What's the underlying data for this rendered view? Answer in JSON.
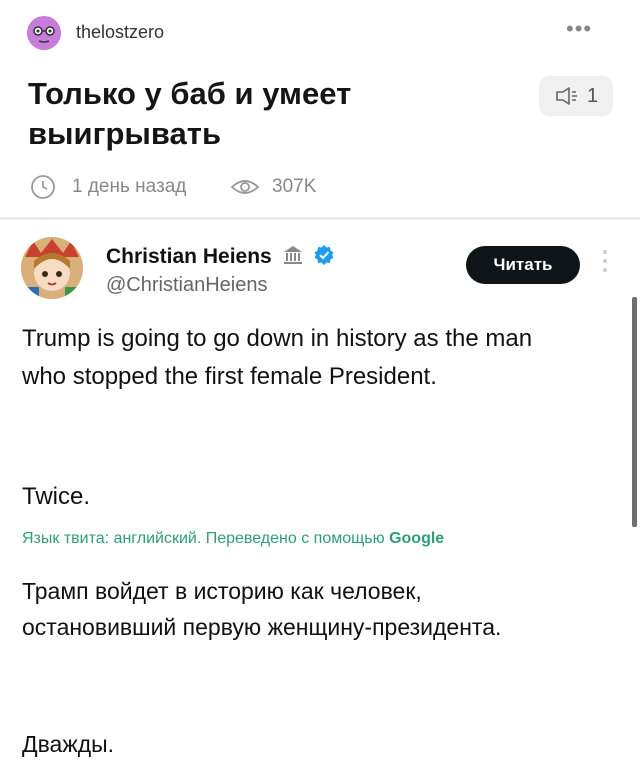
{
  "post": {
    "username": "thelostzero",
    "more_label": "•••",
    "title": "Только у баб и умеет выигрывать",
    "comment_count": "1",
    "time_ago": "1 день назад",
    "views": "307K"
  },
  "tweet": {
    "author_name": "Christian Heiens",
    "author_handle": "@ChristianHeiens",
    "read_button": "Читать",
    "text_line1": "Trump is going to go down in history as the man who stopped the first female President.",
    "text_line2": "Twice.",
    "translation_note": "Язык твита: английский. Переведено с помощью",
    "translation_provider": "Google",
    "translated_line1": "Трамп войдет в историю как человек, остановивший первую женщину-президента.",
    "translated_line2": "Дважды."
  },
  "colors": {
    "avatar_bg": "#c77dd9",
    "verified": "#1d9bf0",
    "translate_green": "#2f9d78",
    "button_dark": "#0f1419"
  }
}
